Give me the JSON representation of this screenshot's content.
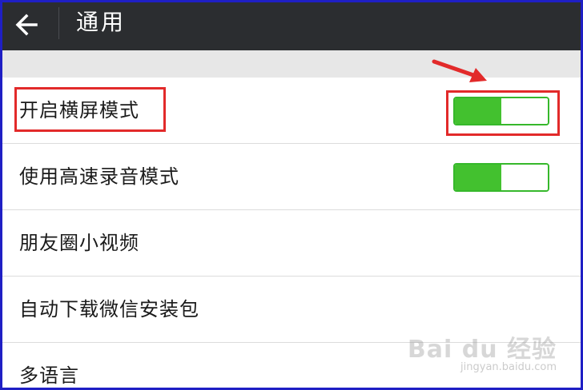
{
  "header": {
    "title": "通用",
    "back_icon": "arrow-left-icon"
  },
  "settings": [
    {
      "label": "开启横屏模式",
      "toggle": true,
      "on": true,
      "on_fraction": 0.5
    },
    {
      "label": "使用高速录音模式",
      "toggle": true,
      "on": true,
      "on_fraction": 0.5
    },
    {
      "label": "朋友圈小视频",
      "toggle": false
    },
    {
      "label": "自动下载微信安装包",
      "toggle": false
    },
    {
      "label": "多语言",
      "toggle": false
    }
  ],
  "watermark": {
    "logo": "Bai du 经验",
    "url": "jingyan.baidu.com"
  },
  "colors": {
    "topbar": "#2b2d30",
    "toggle_on": "#43c12f",
    "annotation": "#e22a2a",
    "frame": "#1f1fc4"
  }
}
